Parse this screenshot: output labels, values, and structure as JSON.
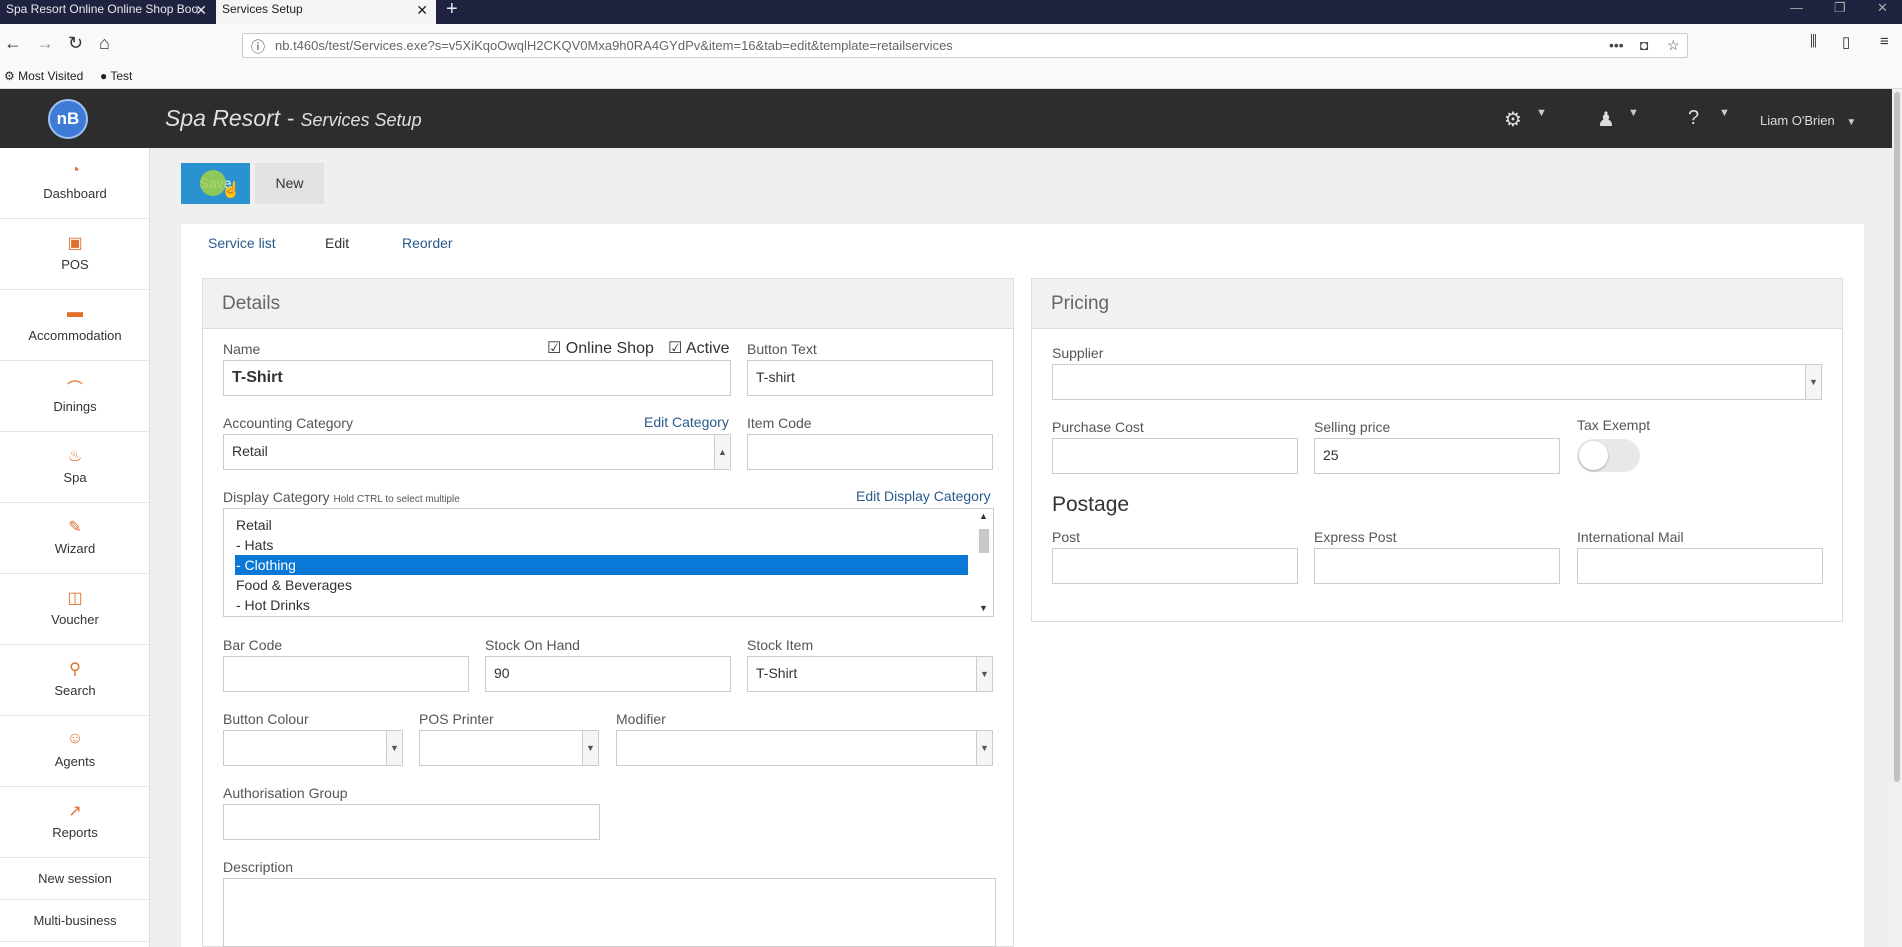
{
  "browser": {
    "tabs": [
      {
        "label": "Spa Resort Online Online Shop Boo"
      },
      {
        "label": "Services Setup"
      }
    ],
    "url": "nb.t460s/test/Services.exe?s=v5XiKqoOwqlH2CKQV0Mxa9h0RA4GYdPv&item=16&tab=edit&template=retailservices",
    "bookmarks": [
      {
        "label": "Most Visited"
      },
      {
        "label": "Test"
      }
    ]
  },
  "header": {
    "logo": "nB",
    "title": "Spa Resort",
    "separator": " - ",
    "subtitle": "Services Setup",
    "user": "Liam O'Brien"
  },
  "sidebar": {
    "items": [
      {
        "label": "Dashboard",
        "icon": "dashboard-icon"
      },
      {
        "label": "POS",
        "icon": "pos-icon"
      },
      {
        "label": "Accommodation",
        "icon": "bed-icon"
      },
      {
        "label": "Dinings",
        "icon": "dining-icon"
      },
      {
        "label": "Spa",
        "icon": "spa-icon"
      },
      {
        "label": "Wizard",
        "icon": "wand-icon"
      },
      {
        "label": "Voucher",
        "icon": "gift-icon"
      },
      {
        "label": "Search",
        "icon": "search-icon"
      },
      {
        "label": "Agents",
        "icon": "agent-icon"
      },
      {
        "label": "Reports",
        "icon": "chart-icon"
      }
    ],
    "links": [
      {
        "label": "New session"
      },
      {
        "label": "Multi-business"
      }
    ]
  },
  "toolbar": {
    "save_label": "Save",
    "new_label": "New"
  },
  "tabs": [
    {
      "label": "Service list"
    },
    {
      "label": "Edit"
    },
    {
      "label": "Reorder"
    }
  ],
  "details": {
    "title": "Details",
    "name_label": "Name",
    "name_value": "T-Shirt",
    "online_shop_label": "Online Shop",
    "online_shop_checked": true,
    "active_label": "Active",
    "active_checked": true,
    "button_text_label": "Button Text",
    "button_text_value": "T-shirt",
    "accounting_label": "Accounting Category",
    "edit_category_link": "Edit Category",
    "accounting_value": "Retail",
    "item_code_label": "Item Code",
    "item_code_value": "",
    "display_category_label": "Display Category",
    "display_category_hint": "Hold CTRL to select multiple",
    "edit_display_category_link": "Edit Display Category",
    "display_options": [
      {
        "label": "Retail",
        "selected": false
      },
      {
        "label": "- Hats",
        "selected": false
      },
      {
        "label": "- Clothing",
        "selected": true
      },
      {
        "label": "Food & Beverages",
        "selected": false
      },
      {
        "label": "- Hot Drinks",
        "selected": false
      }
    ],
    "bar_code_label": "Bar Code",
    "bar_code_value": "",
    "stock_on_hand_label": "Stock On Hand",
    "stock_on_hand_value": "90",
    "stock_item_label": "Stock Item",
    "stock_item_value": "T-Shirt",
    "button_colour_label": "Button Colour",
    "pos_printer_label": "POS Printer",
    "modifier_label": "Modifier",
    "auth_group_label": "Authorisation Group",
    "description_label": "Description"
  },
  "pricing": {
    "title": "Pricing",
    "supplier_label": "Supplier",
    "purchase_cost_label": "Purchase Cost",
    "purchase_cost_value": "",
    "selling_price_label": "Selling price",
    "selling_price_value": "25",
    "tax_exempt_label": "Tax Exempt",
    "tax_exempt_on": false,
    "postage_title": "Postage",
    "post_label": "Post",
    "express_post_label": "Express Post",
    "international_label": "International Mail"
  },
  "colors": {
    "accent": "#2a92d0",
    "header_bg": "#2d2d2d",
    "icon": "#e0702a",
    "selection": "#0a78d7"
  }
}
